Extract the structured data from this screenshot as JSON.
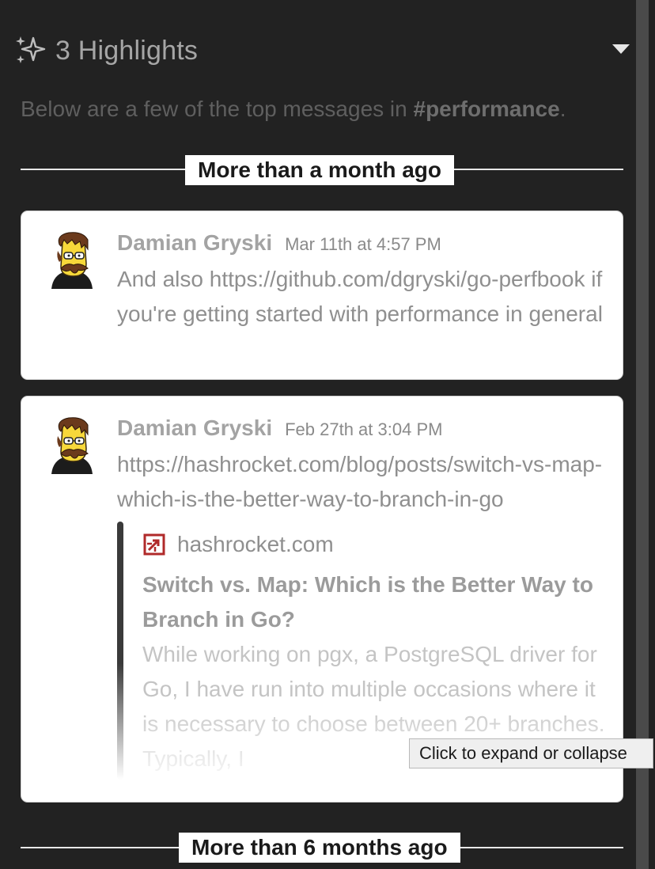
{
  "header": {
    "title": "3 Highlights",
    "icon": "sparkle-icon",
    "toggle_icon": "caret-down-icon"
  },
  "intro": {
    "prefix": "Below are a few of the top messages in ",
    "channel": "#performance",
    "suffix": "."
  },
  "sections": [
    {
      "label": "More than a month ago"
    },
    {
      "label": "More than 6 months ago"
    }
  ],
  "messages": [
    {
      "author": "Damian Gryski",
      "timestamp": "Mar 11th at 4:57 PM",
      "text_before": "And also ",
      "link": "https://github.com/dgryski/go-perfbook",
      "text_after": " if you're getting started with performance in general"
    },
    {
      "author": "Damian Gryski",
      "timestamp": "Feb 27th at 3:04 PM",
      "link": "https://hashrocket.com/blog/posts/switch-vs-map-which-is-the-better-way-to-branch-in-go",
      "attachment": {
        "site": "hashrocket.com",
        "title": "Switch vs. Map: Which is the Better Way to Branch in Go?",
        "description": "While working on pgx, a PostgreSQL driver for Go, I have run into multiple occasions where it is necessary to choose between 20+ branches. Typically, I"
      }
    }
  ],
  "tooltip": {
    "text": "Click to expand or collapse"
  },
  "colors": {
    "background": "#222222",
    "card": "#ffffff",
    "brand": "#b02a2a"
  }
}
